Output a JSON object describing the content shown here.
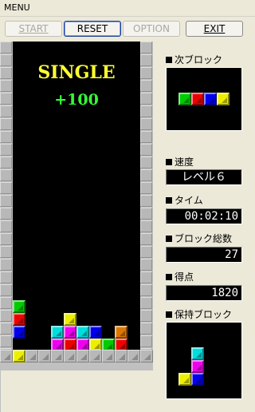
{
  "menu": {
    "label": "MENU"
  },
  "toolbar": {
    "start": "START",
    "reset": "RESET",
    "option": "OPTION",
    "exit": "EXIT"
  },
  "game": {
    "message_line1": "SINGLE",
    "message_line2": "+100"
  },
  "panel": {
    "next_label": "次ブロック",
    "speed_label": "速度",
    "speed_value": "レベル６",
    "time_label": "タイム",
    "time_value": "00:02:10",
    "blocks_label": "ブロック総数",
    "blocks_value": "27",
    "score_label": "得点",
    "score_value": "1820",
    "hold_label": "保持ブロック"
  },
  "colors": {
    "green": "#00cc00",
    "red": "#ee0000",
    "blue": "#0000ee",
    "yellow": "#eeee00",
    "cyan": "#00dddd",
    "magenta": "#ee00ee",
    "orange": "#dd7700",
    "msg_yellow": "#ffff33",
    "msg_green": "#33ff33"
  },
  "board": {
    "columns": 10,
    "rows": [
      [
        "green",
        null,
        null,
        null,
        null,
        null,
        null,
        null,
        null,
        null
      ],
      [
        "red",
        null,
        null,
        null,
        "yellow",
        null,
        null,
        null,
        null,
        null
      ],
      [
        "blue",
        null,
        null,
        "cyan",
        "magenta",
        "cyan",
        "blue",
        null,
        "orange",
        null
      ],
      [
        null,
        null,
        null,
        "magenta",
        "red",
        "magenta",
        "yellow",
        "green",
        "red",
        null
      ]
    ],
    "floor_row": [
      "yellow",
      null,
      null,
      null,
      null,
      null,
      null,
      null,
      null,
      null
    ]
  },
  "next_piece": [
    "green",
    "red",
    "blue",
    "yellow"
  ],
  "hold_piece": [
    [
      null,
      "cyan"
    ],
    [
      null,
      "magenta"
    ],
    [
      "yellow",
      "blue"
    ]
  ]
}
